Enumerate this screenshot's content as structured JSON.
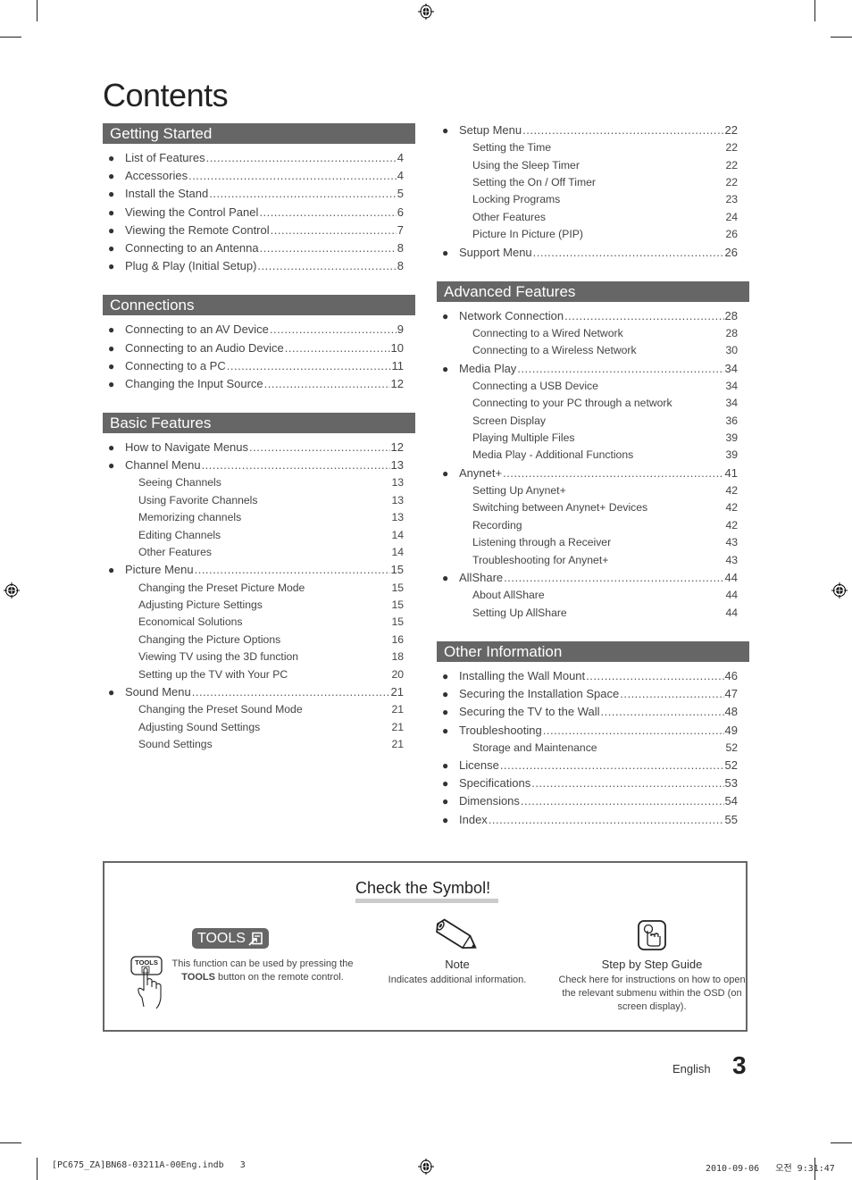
{
  "page_title": "Contents",
  "sections_left": [
    {
      "title": "Getting Started",
      "items": [
        {
          "type": "main",
          "label": "List of Features",
          "page": "4"
        },
        {
          "type": "main",
          "label": "Accessories",
          "page": "4"
        },
        {
          "type": "main",
          "label": "Install the Stand",
          "page": "5"
        },
        {
          "type": "main",
          "label": "Viewing the Control Panel",
          "page": "6"
        },
        {
          "type": "main",
          "label": "Viewing the Remote Control",
          "page": "7"
        },
        {
          "type": "main",
          "label": "Connecting to an Antenna",
          "page": "8"
        },
        {
          "type": "main",
          "label": "Plug & Play (Initial Setup)",
          "page": "8"
        }
      ]
    },
    {
      "title": "Connections",
      "items": [
        {
          "type": "main",
          "label": "Connecting to an AV Device",
          "page": "9"
        },
        {
          "type": "main",
          "label": "Connecting to an Audio Device",
          "page": "10"
        },
        {
          "type": "main",
          "label": "Connecting to a PC",
          "page": "11"
        },
        {
          "type": "main",
          "label": "Changing the Input Source",
          "page": "12"
        }
      ]
    },
    {
      "title": "Basic Features",
      "items": [
        {
          "type": "main",
          "label": "How to Navigate Menus",
          "page": "12"
        },
        {
          "type": "main",
          "label": "Channel Menu",
          "page": "13"
        },
        {
          "type": "sub",
          "label": "Seeing Channels",
          "page": "13"
        },
        {
          "type": "sub",
          "label": "Using Favorite Channels",
          "page": "13"
        },
        {
          "type": "sub",
          "label": "Memorizing channels",
          "page": "13"
        },
        {
          "type": "sub",
          "label": "Editing Channels",
          "page": "14"
        },
        {
          "type": "sub",
          "label": "Other Features",
          "page": "14"
        },
        {
          "type": "main",
          "label": "Picture Menu",
          "page": "15"
        },
        {
          "type": "sub",
          "label": "Changing the Preset Picture Mode",
          "page": "15"
        },
        {
          "type": "sub",
          "label": "Adjusting Picture Settings",
          "page": "15"
        },
        {
          "type": "sub",
          "label": "Economical Solutions",
          "page": "15"
        },
        {
          "type": "sub",
          "label": "Changing the Picture Options",
          "page": "16"
        },
        {
          "type": "sub",
          "label": "Viewing TV using the 3D function",
          "page": "18"
        },
        {
          "type": "sub",
          "label": "Setting up the TV with Your PC",
          "page": "20"
        },
        {
          "type": "main",
          "label": "Sound Menu",
          "page": "21"
        },
        {
          "type": "sub",
          "label": "Changing the Preset Sound Mode",
          "page": "21"
        },
        {
          "type": "sub",
          "label": "Adjusting Sound Settings",
          "page": "21"
        },
        {
          "type": "sub",
          "label": "Sound Settings",
          "page": "21"
        }
      ]
    }
  ],
  "sections_right": [
    {
      "title": "",
      "items": [
        {
          "type": "main",
          "label": "Setup Menu",
          "page": "22"
        },
        {
          "type": "sub",
          "label": "Setting the Time",
          "page": "22"
        },
        {
          "type": "sub",
          "label": "Using the Sleep Timer",
          "page": "22"
        },
        {
          "type": "sub",
          "label": "Setting the On / Off Timer",
          "page": "22"
        },
        {
          "type": "sub",
          "label": "Locking Programs",
          "page": "23"
        },
        {
          "type": "sub",
          "label": "Other Features",
          "page": "24"
        },
        {
          "type": "sub",
          "label": "Picture In Picture (PIP)",
          "page": "26"
        },
        {
          "type": "main",
          "label": "Support Menu",
          "page": "26"
        }
      ]
    },
    {
      "title": "Advanced Features",
      "items": [
        {
          "type": "main",
          "label": "Network Connection",
          "page": "28"
        },
        {
          "type": "sub",
          "label": "Connecting to a Wired Network",
          "page": "28"
        },
        {
          "type": "sub",
          "label": "Connecting to a Wireless Network",
          "page": "30"
        },
        {
          "type": "main",
          "label": "Media Play",
          "page": "34"
        },
        {
          "type": "sub",
          "label": "Connecting a USB Device",
          "page": "34"
        },
        {
          "type": "sub",
          "label": "Connecting to your PC through a network",
          "page": "34"
        },
        {
          "type": "sub",
          "label": "Screen Display",
          "page": "36"
        },
        {
          "type": "sub",
          "label": "Playing Multiple Files",
          "page": "39"
        },
        {
          "type": "sub",
          "label": "Media Play - Additional Functions",
          "page": "39"
        },
        {
          "type": "main",
          "label": "Anynet+",
          "page": "41"
        },
        {
          "type": "sub",
          "label": "Setting Up Anynet+",
          "page": "42"
        },
        {
          "type": "sub",
          "label": "Switching between Anynet+ Devices",
          "page": "42"
        },
        {
          "type": "sub",
          "label": "Recording",
          "page": "42"
        },
        {
          "type": "sub",
          "label": "Listening through a Receiver",
          "page": "43"
        },
        {
          "type": "sub",
          "label": "Troubleshooting for Anynet+",
          "page": "43"
        },
        {
          "type": "main",
          "label": "AllShare",
          "page": "44"
        },
        {
          "type": "sub",
          "label": "About AllShare",
          "page": "44"
        },
        {
          "type": "sub",
          "label": "Setting Up AllShare",
          "page": "44"
        }
      ]
    },
    {
      "title": "Other Information",
      "items": [
        {
          "type": "main",
          "label": "Installing the Wall Mount",
          "page": "46"
        },
        {
          "type": "main",
          "label": "Securing the Installation Space",
          "page": "47"
        },
        {
          "type": "main",
          "label": "Securing the TV to the Wall",
          "page": "48"
        },
        {
          "type": "main",
          "label": "Troubleshooting",
          "page": "49"
        },
        {
          "type": "sub",
          "label": "Storage and Maintenance",
          "page": "52"
        },
        {
          "type": "main",
          "label": "License",
          "page": "52"
        },
        {
          "type": "main",
          "label": "Specifications",
          "page": "53"
        },
        {
          "type": "main",
          "label": "Dimensions",
          "page": "54"
        },
        {
          "type": "main",
          "label": "Index",
          "page": "55"
        }
      ]
    }
  ],
  "symbols": {
    "title": "Check the Symbol!",
    "tools_badge": "TOOLS",
    "tools_button_label": "TOOLS",
    "tools_text_line1": "This function can be used by pressing the",
    "tools_text_bold": "TOOLS",
    "tools_text_line2": " button on the remote control.",
    "note_label": "Note",
    "note_text": "Indicates additional information.",
    "guide_label": "Step by Step Guide",
    "guide_text": "Check here for instructions on how to open the relevant submenu within the OSD (on screen display)."
  },
  "footer": {
    "language": "English",
    "page_number": "3",
    "slug_left": "[PC675_ZA]BN68-03211A-00Eng.indb   3",
    "slug_right": "2010-09-06   오전 9:31:47"
  },
  "colors": {
    "section_header_bg": "#666666",
    "section_header_text": "#ffffff",
    "text": "#444444"
  }
}
